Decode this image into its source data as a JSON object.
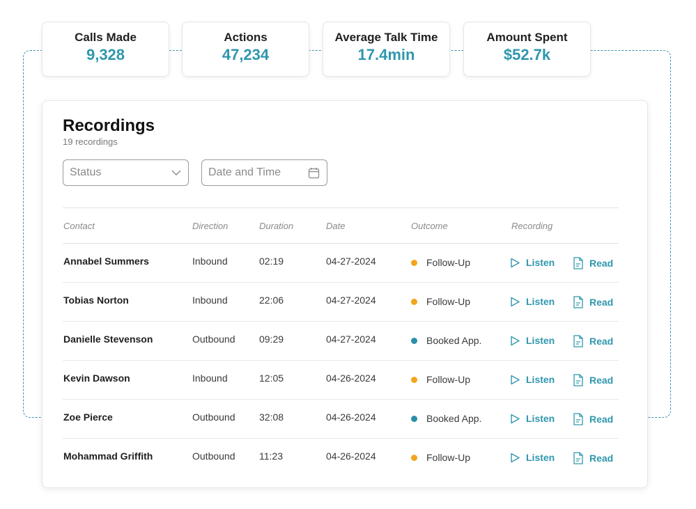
{
  "colors": {
    "accent": "#2f97ad",
    "follow_up": "#f2a51c",
    "booked": "#2a8fa8"
  },
  "stats": [
    {
      "label": "Calls Made",
      "value": "9,328"
    },
    {
      "label": "Actions",
      "value": "47,234"
    },
    {
      "label": "Average Talk Time",
      "value": "17.4min"
    },
    {
      "label": "Amount Spent",
      "value": "$52.7k"
    }
  ],
  "recordings": {
    "title": "Recordings",
    "subtitle": "19 recordings",
    "filters": {
      "status": "Status",
      "date": "Date and Time"
    },
    "columns": {
      "contact": "Contact",
      "direction": "Direction",
      "duration": "Duration",
      "date": "Date",
      "outcome": "Outcome",
      "recording": "Recording"
    },
    "listen_label": "Listen",
    "read_label": "Read",
    "rows": [
      {
        "contact": "Annabel Summers",
        "direction": "Inbound",
        "duration": "02:19",
        "date": "04-27-2024",
        "outcome": "Follow-Up",
        "outcome_color": "#f2a51c"
      },
      {
        "contact": "Tobias Norton",
        "direction": "Inbound",
        "duration": "22:06",
        "date": "04-27-2024",
        "outcome": "Follow-Up",
        "outcome_color": "#f2a51c"
      },
      {
        "contact": "Danielle Stevenson",
        "direction": "Outbound",
        "duration": "09:29",
        "date": "04-27-2024",
        "outcome": "Booked App.",
        "outcome_color": "#2a8fa8"
      },
      {
        "contact": "Kevin Dawson",
        "direction": "Inbound",
        "duration": "12:05",
        "date": "04-26-2024",
        "outcome": "Follow-Up",
        "outcome_color": "#f2a51c"
      },
      {
        "contact": "Zoe Pierce",
        "direction": "Outbound",
        "duration": "32:08",
        "date": "04-26-2024",
        "outcome": "Booked App.",
        "outcome_color": "#2a8fa8"
      },
      {
        "contact": "Mohammad Griffith",
        "direction": "Outbound",
        "duration": "11:23",
        "date": "04-26-2024",
        "outcome": "Follow-Up",
        "outcome_color": "#f2a51c"
      }
    ]
  }
}
